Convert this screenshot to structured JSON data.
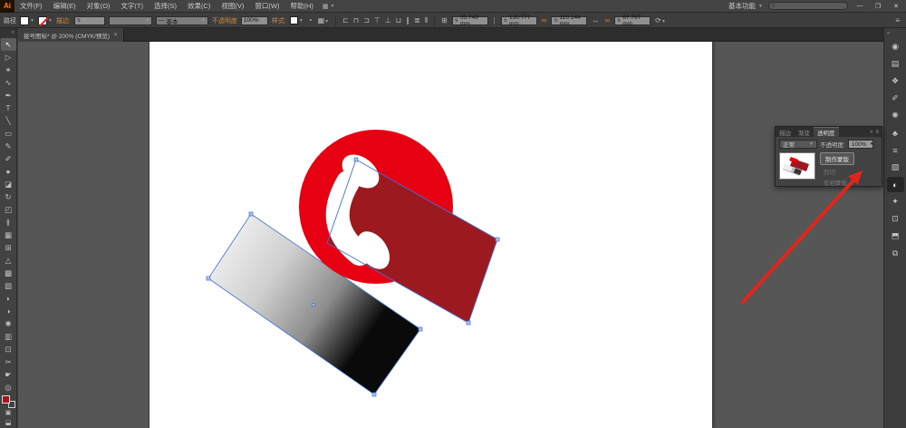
{
  "window": {
    "app_badge": "Ai",
    "workspace": "基本功能",
    "search_placeholder": "",
    "minimize": "—",
    "restore": "❐",
    "close": "✕"
  },
  "menubar": {
    "items": [
      "文件(F)",
      "编辑(E)",
      "对象(O)",
      "文字(T)",
      "选择(S)",
      "效果(C)",
      "视图(V)",
      "窗口(W)",
      "帮助(H)"
    ]
  },
  "control_bar": {
    "object_label": "路径",
    "stroke_label": "描边:",
    "brush_label": "基本",
    "opacity_label": "不透明度",
    "opacity_value": "100%",
    "style_label": "样式:",
    "transform": {
      "x": "55.749 mm",
      "y": "130.777 mm",
      "w": "110.144 mm",
      "h": "87.767 mm"
    }
  },
  "document_tab": {
    "title": "拨号图标* @ 200% (CMYK/预览)",
    "close": "✕",
    "zoom_level": "200%",
    "color_mode": "CMYK/预览"
  },
  "toolbar": {
    "collapse": "«",
    "tools": [
      {
        "name": "selection-tool",
        "glyph": "↖",
        "active": true
      },
      {
        "name": "direct-selection-tool",
        "glyph": "▷",
        "active": false
      },
      {
        "name": "magic-wand-tool",
        "glyph": "✶",
        "active": false
      },
      {
        "name": "lasso-tool",
        "glyph": "∿",
        "active": false
      },
      {
        "name": "pen-tool",
        "glyph": "✒",
        "active": false
      },
      {
        "name": "type-tool",
        "glyph": "T",
        "active": false
      },
      {
        "name": "line-segment-tool",
        "glyph": "╲",
        "active": false
      },
      {
        "name": "rectangle-tool",
        "glyph": "▭",
        "active": false
      },
      {
        "name": "pencil-tool",
        "glyph": "✎",
        "active": false
      },
      {
        "name": "paintbrush-tool",
        "glyph": "✐",
        "active": false
      },
      {
        "name": "blob-brush-tool",
        "glyph": "●",
        "active": false
      },
      {
        "name": "eraser-tool",
        "glyph": "◪",
        "active": false
      },
      {
        "name": "rotate-tool",
        "glyph": "↻",
        "active": false
      },
      {
        "name": "scale-tool",
        "glyph": "◰",
        "active": false
      },
      {
        "name": "width-tool",
        "glyph": "≬",
        "active": false
      },
      {
        "name": "free-transform-tool",
        "glyph": "▦",
        "active": false
      },
      {
        "name": "shape-builder-tool",
        "glyph": "⊞",
        "active": false
      },
      {
        "name": "perspective-grid-tool",
        "glyph": "△",
        "active": false
      },
      {
        "name": "mesh-tool",
        "glyph": "▩",
        "active": false
      },
      {
        "name": "gradient-tool",
        "glyph": "▧",
        "active": false
      },
      {
        "name": "eyedropper-tool",
        "glyph": "◗",
        "active": false
      },
      {
        "name": "blend-tool",
        "glyph": "◑",
        "active": false
      },
      {
        "name": "symbol-sprayer-tool",
        "glyph": "✺",
        "active": false
      },
      {
        "name": "column-graph-tool",
        "glyph": "▥",
        "active": false
      },
      {
        "name": "artboard-tool",
        "glyph": "⊡",
        "active": false
      },
      {
        "name": "slice-tool",
        "glyph": "✂",
        "active": false
      },
      {
        "name": "hand-tool",
        "glyph": "☛",
        "active": false
      },
      {
        "name": "zoom-tool",
        "glyph": "◎",
        "active": false
      }
    ],
    "mode_icons": [
      {
        "name": "drawing-mode-icon",
        "glyph": "▣"
      },
      {
        "name": "screen-mode-icon",
        "glyph": "⬓"
      }
    ]
  },
  "dock": {
    "collapse": "«",
    "icons": [
      {
        "name": "color-panel-icon",
        "glyph": "◉",
        "active": false
      },
      {
        "name": "color-guide-panel-icon",
        "glyph": "▤",
        "active": false
      },
      {
        "name": "swatches-panel-icon",
        "glyph": "❖",
        "active": false
      },
      {
        "name": "brushes-panel-icon",
        "glyph": "✐",
        "active": false
      },
      {
        "name": "symbols-panel-icon",
        "glyph": "✺",
        "active": false
      },
      {
        "name": "appearance-panel-icon",
        "glyph": "♣",
        "active": false
      },
      {
        "name": "stroke-panel-icon",
        "glyph": "≡",
        "active": false
      },
      {
        "name": "gradient-panel-icon",
        "glyph": "▧",
        "active": false
      },
      {
        "name": "transparency-panel-icon",
        "glyph": "◐",
        "active": true
      },
      {
        "name": "graphic-styles-panel-icon",
        "glyph": "✦",
        "active": false
      },
      {
        "name": "artboards-panel-icon",
        "glyph": "⊡",
        "active": false
      },
      {
        "name": "layers-panel-icon",
        "glyph": "⬒",
        "active": false
      },
      {
        "name": "pathfinder-panel-icon",
        "glyph": "⧉",
        "active": false
      }
    ]
  },
  "transparency_panel": {
    "tabs": [
      {
        "label": "描边",
        "active": false
      },
      {
        "label": "渐变",
        "active": false
      },
      {
        "label": "透明度",
        "active": true
      }
    ],
    "tab_icons": [
      "»",
      "≡"
    ],
    "blend_mode": "正常",
    "opacity_label": "不透明度:",
    "opacity_value": "100%",
    "make_mask_button": "制作蒙版",
    "options": [
      "剪切",
      "反相蒙版"
    ]
  },
  "artwork": {
    "circle_color": "#e60012",
    "dark_red_color": "#9c1a1f",
    "phone_color": "#ffffff",
    "gradient_start": "#ffffff",
    "gradient_mid": "#8c8c8c",
    "gradient_end": "#0a0a0a",
    "selection_color": "#3f6fd8",
    "anchor_fill": "#aac4f0",
    "annotation_arrow_color": "#e0261b"
  }
}
